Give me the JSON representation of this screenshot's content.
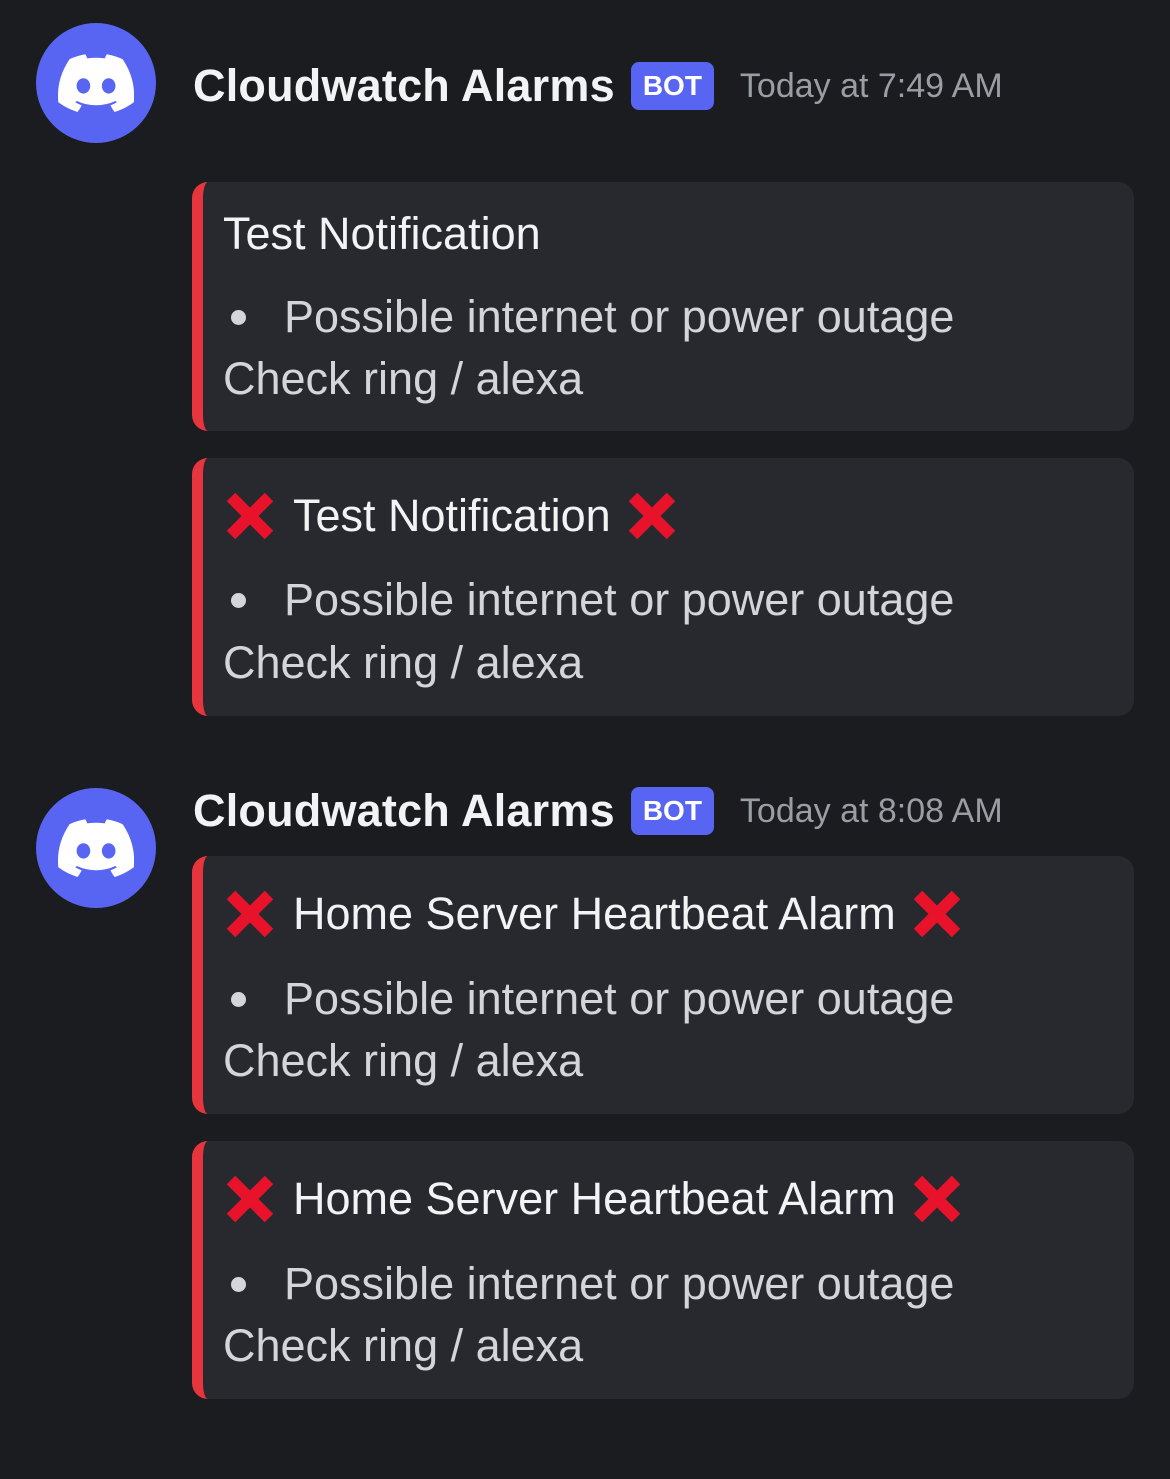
{
  "colors": {
    "background": "#1b1c20",
    "embed_background": "#28292f",
    "embed_accent": "#e6353c",
    "avatar": "#5865f2",
    "bot_badge": "#5865f2",
    "x_mark": "#e8132a"
  },
  "messages": [
    {
      "author": "Cloudwatch Alarms",
      "badge": "BOT",
      "timestamp": "Today at 7:49 AM",
      "avatar_icon": "discord-logo-icon",
      "embeds": [
        {
          "title": "Test Notification",
          "has_x_icons": false,
          "bullet": "Possible internet or power outage",
          "description": "Check ring / alexa"
        },
        {
          "title": "Test Notification",
          "has_x_icons": true,
          "icon": "cross-mark-icon",
          "bullet": "Possible internet or power outage",
          "description": "Check ring / alexa"
        }
      ]
    },
    {
      "author": "Cloudwatch Alarms",
      "badge": "BOT",
      "timestamp": "Today at 8:08 AM",
      "avatar_icon": "discord-logo-icon",
      "embeds": [
        {
          "title": "Home Server Heartbeat Alarm",
          "has_x_icons": true,
          "icon": "cross-mark-icon",
          "bullet": "Possible internet or power outage",
          "description": "Check ring / alexa"
        },
        {
          "title": "Home Server Heartbeat Alarm",
          "has_x_icons": true,
          "icon": "cross-mark-icon",
          "bullet": "Possible internet or power outage",
          "description": "Check ring / alexa"
        }
      ]
    }
  ]
}
